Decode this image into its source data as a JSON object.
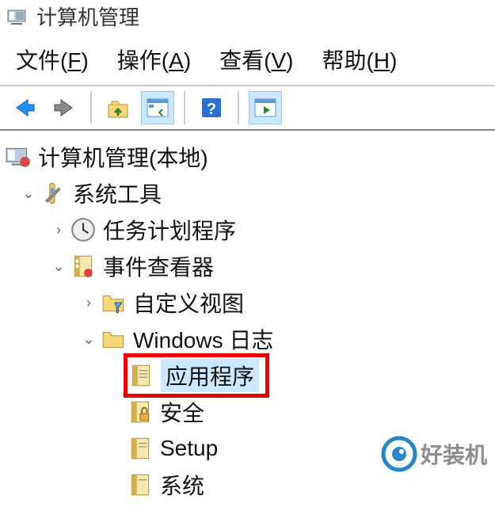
{
  "window": {
    "title": "计算机管理"
  },
  "menu": {
    "file": {
      "label": "文件",
      "key": "F"
    },
    "action": {
      "label": "操作",
      "key": "A"
    },
    "view": {
      "label": "查看",
      "key": "V"
    },
    "help": {
      "label": "帮助",
      "key": "H"
    }
  },
  "toolbar": {
    "back": "back-icon",
    "forward": "forward-icon",
    "up": "up-icon",
    "props": "properties-icon",
    "help": "help-icon",
    "show": "show-pane-icon"
  },
  "tree": {
    "root": {
      "label": "计算机管理(本地)"
    },
    "systemTools": {
      "label": "系统工具"
    },
    "taskScheduler": {
      "label": "任务计划程序"
    },
    "eventViewer": {
      "label": "事件查看器"
    },
    "customViews": {
      "label": "自定义视图"
    },
    "windowsLogs": {
      "label": "Windows 日志"
    },
    "application": {
      "label": "应用程序"
    },
    "security": {
      "label": "安全"
    },
    "setup": {
      "label": "Setup"
    },
    "system": {
      "label": "系统"
    }
  },
  "watermark": {
    "text": "好装机"
  }
}
